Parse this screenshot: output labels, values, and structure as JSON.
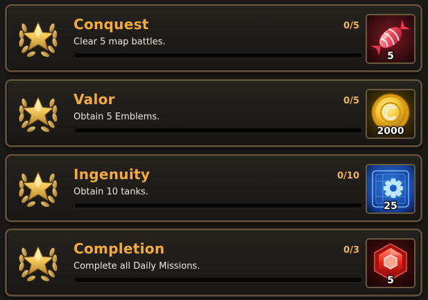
{
  "missions": [
    {
      "title": "Conquest",
      "description": "Clear 5 map battles.",
      "progress_text": "0/5",
      "progress_fraction": 0,
      "reward": {
        "icon": "candy-icon",
        "quantity": "5"
      }
    },
    {
      "title": "Valor",
      "description": "Obtain 5 Emblems.",
      "progress_text": "0/5",
      "progress_fraction": 0,
      "reward": {
        "icon": "gold-coin-icon",
        "quantity": "2000"
      }
    },
    {
      "title": "Ingenuity",
      "description": "Obtain 10 tanks.",
      "progress_text": "0/10",
      "progress_fraction": 0,
      "reward": {
        "icon": "blue-gear-blueprint-icon",
        "quantity": "25"
      }
    },
    {
      "title": "Completion",
      "description": "Complete all Daily Missions.",
      "progress_text": "0/3",
      "progress_fraction": 0,
      "reward": {
        "icon": "red-gem-icon",
        "quantity": "5"
      }
    }
  ],
  "colors": {
    "title": "#f4ab3a",
    "progress_text": "#f0b458",
    "card_border": "#5a4c37"
  }
}
